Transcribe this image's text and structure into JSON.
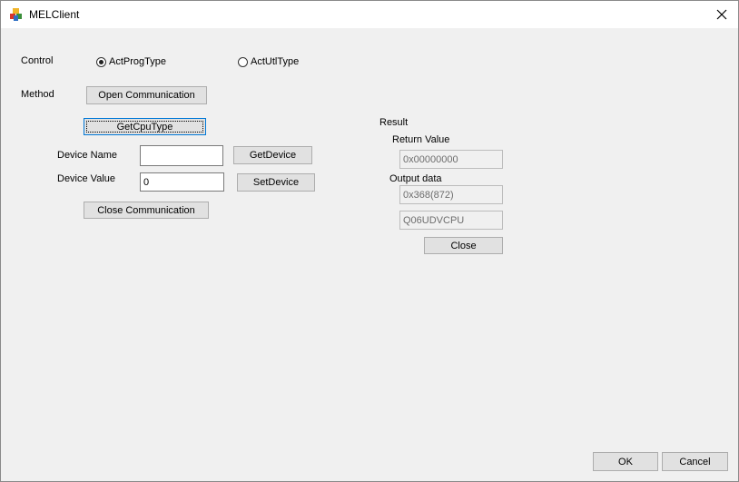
{
  "window": {
    "title": "MELClient",
    "icon": "mel-app-icon",
    "close_icon": "close-icon"
  },
  "control": {
    "label": "Control",
    "options": [
      {
        "label": "ActProgType",
        "selected": true
      },
      {
        "label": "ActUtlType",
        "selected": false
      }
    ]
  },
  "method": {
    "label": "Method",
    "open_button": "Open Communication",
    "getcputype_button": "GetCpuType",
    "device_name_label": "Device Name",
    "device_name_value": "",
    "getdevice_button": "GetDevice",
    "device_value_label": "Device Value",
    "device_value_value": "0",
    "setdevice_button": "SetDevice",
    "close_comm_button": "Close  Communication"
  },
  "result": {
    "label": "Result",
    "return_value_label": "Return Value",
    "return_value": "0x00000000",
    "output_label": "Output data",
    "output_values": [
      "0x368(872)",
      "Q06UDVCPU"
    ],
    "close_button": "Close"
  },
  "footer": {
    "ok_button": "OK",
    "cancel_button": "Cancel"
  }
}
